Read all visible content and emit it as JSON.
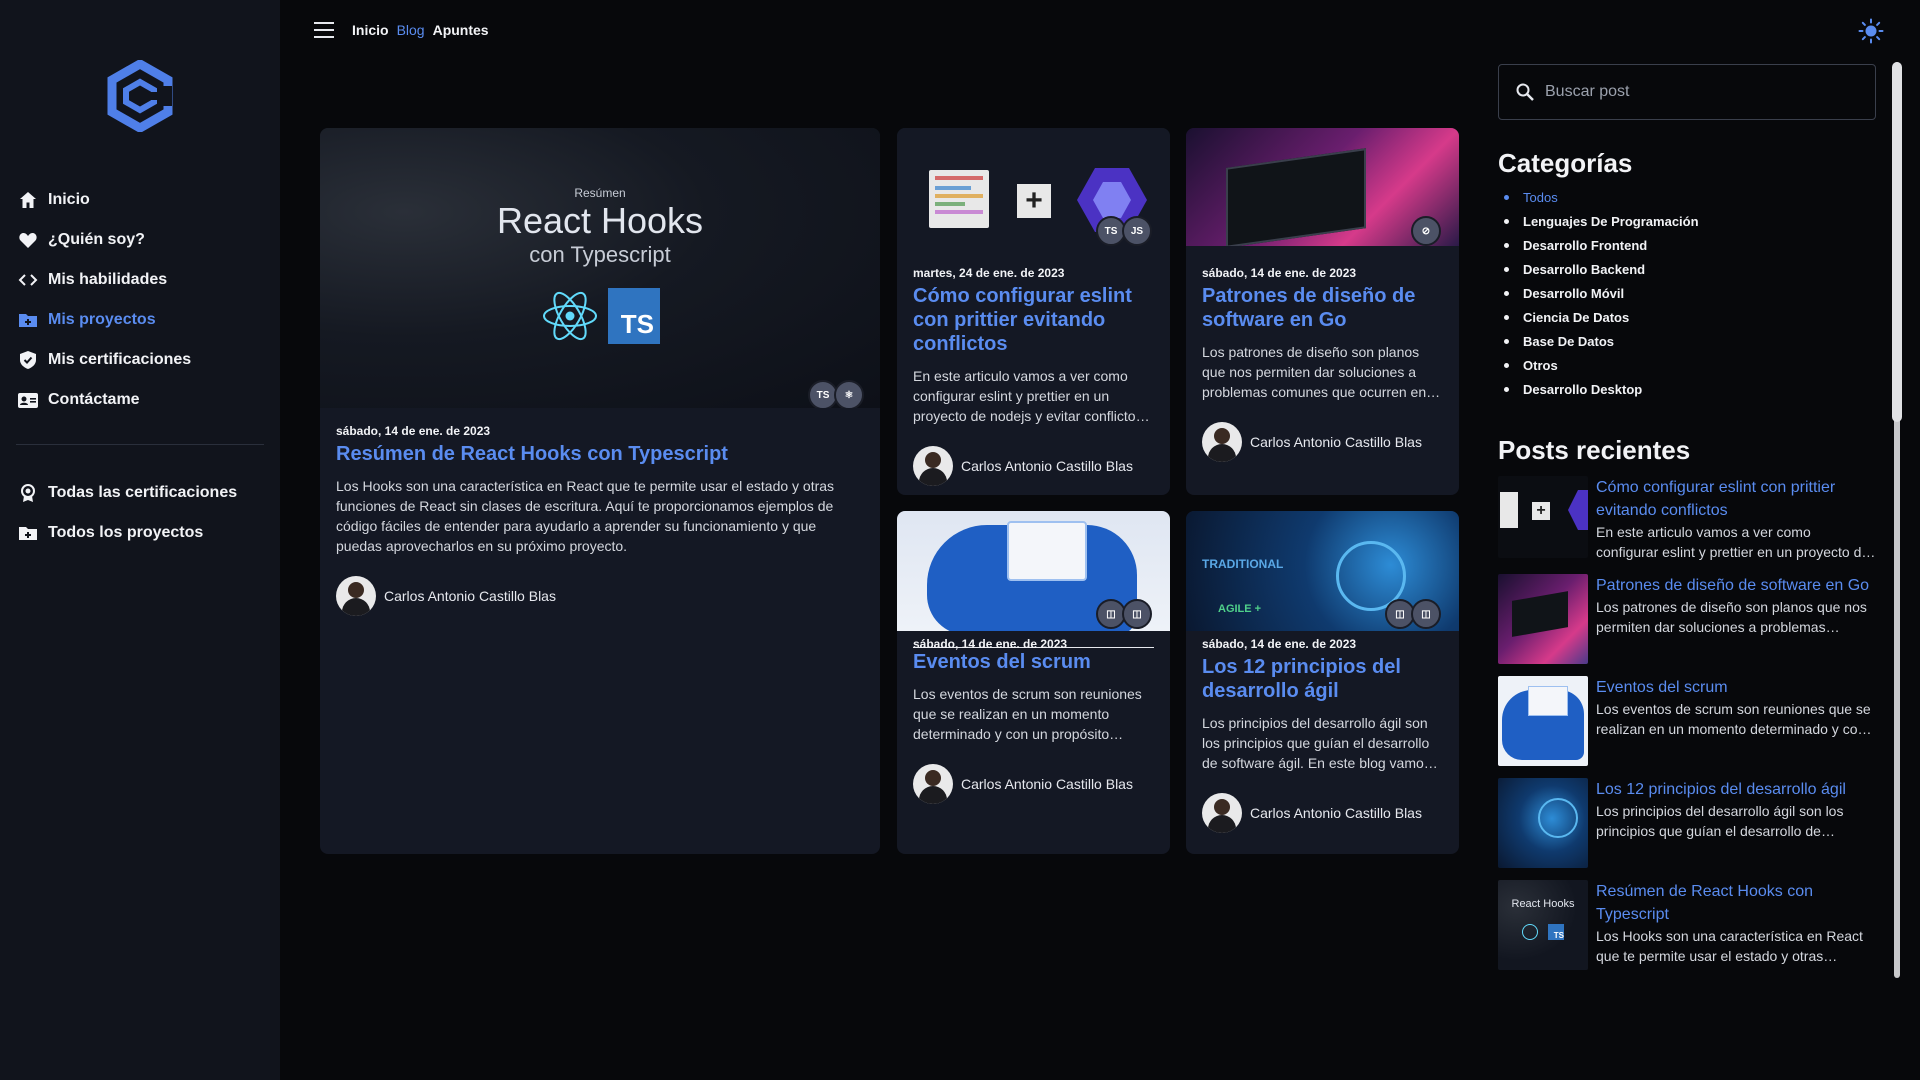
{
  "colors": {
    "accent": "#5a8cf0",
    "sidebar": "#11141c",
    "card": "#141824",
    "background": "#07080b"
  },
  "sidebar": {
    "logo": "logo-icon",
    "items": [
      {
        "label": "Inicio",
        "icon": "home-icon"
      },
      {
        "label": "¿Quién soy?",
        "icon": "heart-icon"
      },
      {
        "label": "Mis habilidades",
        "icon": "code-icon"
      },
      {
        "label": "Mis proyectos",
        "icon": "folder-plus-icon",
        "active": true
      },
      {
        "label": "Mis certificaciones",
        "icon": "shield-check-icon"
      },
      {
        "label": "Contáctame",
        "icon": "contact-card-icon"
      }
    ],
    "secondary": [
      {
        "label": "Todas las certificaciones",
        "icon": "award-icon"
      },
      {
        "label": "Todos los proyectos",
        "icon": "folder-plus-icon"
      }
    ]
  },
  "topbar": {
    "menu_icon": "hamburger-icon",
    "links": [
      {
        "label": "Inicio"
      },
      {
        "label": "Blog",
        "active": true
      },
      {
        "label": "Apuntes"
      }
    ],
    "theme_icon": "sun-icon"
  },
  "posts": [
    {
      "image_sub": "Resúmen",
      "image_title": "React Hooks",
      "image_sub2": "con Typescript",
      "date": "sábado, 14 de ene. de 2023",
      "title": "Resúmen de React Hooks con Typescript",
      "desc": "Los Hooks son una característica en React que te permite usar el estado y otras funciones de React sin clases de escritura. Aquí te proporcionamos ejemplos de código fáciles de entender para ayudarlo a aprender su funcionamiento y que puedas aprovecharlos en su próximo proyecto.",
      "author": "Carlos Antonio Castillo Blas",
      "badges": [
        "TS",
        "⚛"
      ]
    },
    {
      "date": "martes, 24 de ene. de 2023",
      "title": "Cómo configurar eslint con prittier evitando conflictos",
      "desc": "En este articulo vamos a ver como configurar eslint y prettier en un proyecto de nodejs y evitar conflictos entre ellos.",
      "author": "Carlos Antonio Castillo Blas",
      "badges": [
        "TS",
        "JS"
      ]
    },
    {
      "date": "sábado, 14 de ene. de 2023",
      "title": "Patrones de diseño de software en Go",
      "desc": "Los patrones de diseño son planos que nos permiten dar soluciones a problemas comunes que ocurren en la programación.",
      "author": "Carlos Antonio Castillo Blas",
      "badges": [
        "⊘"
      ]
    },
    {
      "date": "sábado, 14 de ene. de 2023",
      "title": "Eventos del scrum",
      "desc": "Los eventos de scrum son reuniones que se realizan en un momento determinado y con un propósito específico.",
      "author": "Carlos Antonio Castillo Blas",
      "badges": [
        "◫",
        "◫"
      ]
    },
    {
      "image_text1": "TRADITIONAL",
      "image_text2": "AGILE +",
      "date": "sábado, 14 de ene. de 2023",
      "title": "Los 12 principios del desarrollo ágil",
      "desc": "Los principios del desarrollo ágil son los principios que guían el desarrollo de software ágil. En este blog vamos a ver cada uno de ellos.",
      "author": "Carlos Antonio Castillo Blas",
      "badges": [
        "◫",
        "◫"
      ]
    }
  ],
  "aside": {
    "search_placeholder": "Buscar post",
    "categories_title": "Categorías",
    "categories": [
      {
        "label": "Todos",
        "active": true
      },
      {
        "label": "Lenguajes De Programación"
      },
      {
        "label": "Desarrollo Frontend"
      },
      {
        "label": "Desarrollo Backend"
      },
      {
        "label": "Desarrollo Móvil"
      },
      {
        "label": "Ciencia De Datos"
      },
      {
        "label": "Base De Datos"
      },
      {
        "label": "Otros"
      },
      {
        "label": "Desarrollo Desktop"
      }
    ],
    "recent_title": "Posts recientes",
    "recent": [
      {
        "title": "Cómo configurar eslint con prittier evitando conflictos",
        "desc": "En este articulo vamos a ver como configurar eslint y prettier en un proyecto de nodejs y evitar conflictos entre ellos."
      },
      {
        "title": "Patrones de diseño de software en Go",
        "desc": "Los patrones de diseño son planos que nos permiten dar soluciones a problemas comunes que ocurren en la programación."
      },
      {
        "title": "Eventos del scrum",
        "desc": "Los eventos de scrum son reuniones que se realizan en un momento determinado y con un propósito específico."
      },
      {
        "title": "Los 12 principios del desarrollo ágil",
        "desc": "Los principios del desarrollo ágil son los principios que guían el desarrollo de software ágil."
      },
      {
        "title": "Resúmen de React Hooks con Typescript",
        "desc": "Los Hooks son una característica en React que te permite usar el estado y otras funciones de React."
      }
    ],
    "thumb_react_title": "React Hooks",
    "thumb_react_ts": "TS"
  }
}
